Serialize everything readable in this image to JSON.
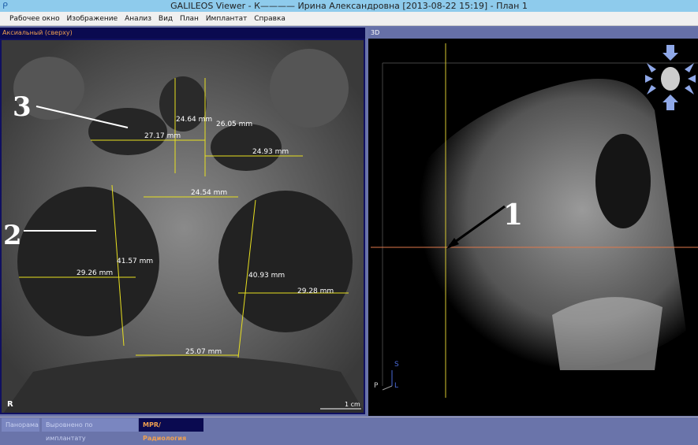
{
  "window": {
    "title": "GALILEOS Viewer - К———— Ирина  Александровна [2013-08-22 15:19] - План 1"
  },
  "menu": [
    "Рабочее окно",
    "Изображение",
    "Анализ",
    "Вид",
    "План",
    "Имплантат",
    "Справка"
  ],
  "left_panel": {
    "title": "Аксиальный (сверху)",
    "orientation": "R",
    "scale": "1 cm",
    "measurements": [
      "24.64 mm",
      "26.05 mm",
      "27.17 mm",
      "24.93 mm",
      "24.54 mm",
      "41.57 mm",
      "29.26 mm",
      "40.93 mm",
      "29.28 mm",
      "25.07 mm"
    ],
    "annotations": [
      "3",
      "2"
    ]
  },
  "right_panel": {
    "title": "3D",
    "annotation": "1",
    "axes": [
      "S",
      "P",
      "L"
    ]
  },
  "tabs": [
    {
      "label": "Панорама"
    },
    {
      "label": "Выровнено по имплантату"
    },
    {
      "label": "MPR/Радиология",
      "active": true
    }
  ],
  "colors": {
    "measure": "#e8e020",
    "header_left": "#0a0a50",
    "header_right": "#6670a8",
    "active_tab": "#0a0a50"
  }
}
